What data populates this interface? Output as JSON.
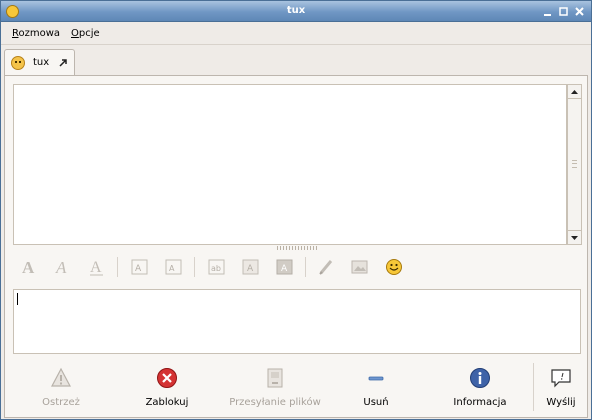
{
  "window": {
    "title": "tux"
  },
  "menu": [
    {
      "label": "Rozmowa"
    },
    {
      "label": "Opcje"
    }
  ],
  "tabs": [
    {
      "label": "tux"
    }
  ],
  "format_toolbar": {
    "buttons": [
      "bold-icon",
      "italic-icon",
      "underline-icon",
      "font-grow-icon",
      "font-shrink-icon",
      "font-face-icon",
      "fg-color-icon",
      "bg-color-icon",
      "insert-link-icon",
      "insert-image-icon",
      "smiley-icon"
    ]
  },
  "actions": [
    {
      "label": "Ostrzeż",
      "enabled": false
    },
    {
      "label": "Zablokuj",
      "enabled": true
    },
    {
      "label": "Przesyłanie plików",
      "enabled": false
    },
    {
      "label": "Usuń",
      "enabled": true
    },
    {
      "label": "Informacja",
      "enabled": true
    },
    {
      "label": "Wyślij",
      "enabled": true
    }
  ],
  "colors": {
    "titlebar": "#7097c4",
    "window_bg": "#efebe7",
    "block": "#d43333",
    "info": "#3f63a8"
  }
}
